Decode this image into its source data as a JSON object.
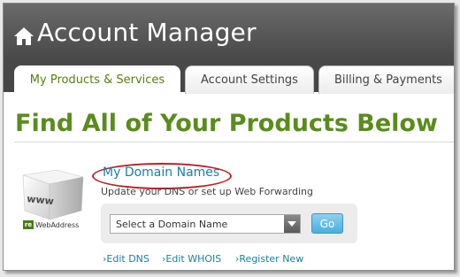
{
  "header": {
    "title": "Account Manager",
    "home_icon": "home-icon"
  },
  "tabs": [
    {
      "label": "My Products & Services",
      "active": true
    },
    {
      "label": "Account Settings",
      "active": false
    },
    {
      "label": "Billing & Payments",
      "active": false
    }
  ],
  "main": {
    "title": "Find All of Your Products Below",
    "product": {
      "logo_text": "www",
      "brand": "WebAddress",
      "brand_mark": "re",
      "heading": "My Domain Names",
      "subtext": "Update your DNS or set up Web Forwarding",
      "select_value": "Select a Domain Name",
      "go_label": "Go",
      "links": [
        {
          "label": "Edit DNS",
          "prefix": "›"
        },
        {
          "label": "Edit WHOIS",
          "prefix": "›"
        },
        {
          "label": "Register New",
          "prefix": "›"
        }
      ]
    }
  },
  "colors": {
    "header_bg": "#4f4f4f",
    "title_green": "#5a8c1c",
    "link_blue": "#1b7fa0",
    "highlight_oval": "#b3242a",
    "go_button": "#4aaede"
  }
}
